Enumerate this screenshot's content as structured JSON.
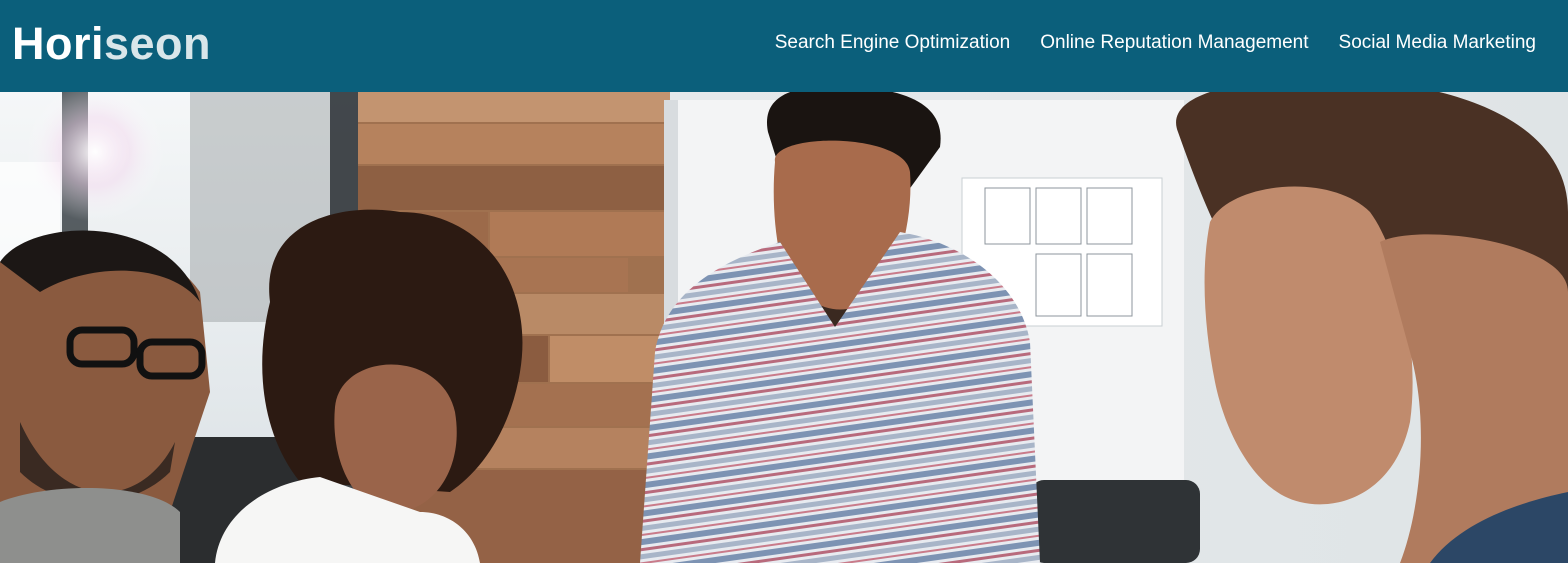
{
  "header": {
    "logo": {
      "prefix": "Hori",
      "accent": "seon"
    },
    "nav": [
      {
        "label": "Search Engine Optimization"
      },
      {
        "label": "Online Reputation Management"
      },
      {
        "label": "Social Media Marketing"
      }
    ]
  },
  "hero": {
    "image": "team-meeting-photo"
  },
  "colors": {
    "header_bg": "#0b5f7b",
    "nav_text": "#ffffff"
  }
}
